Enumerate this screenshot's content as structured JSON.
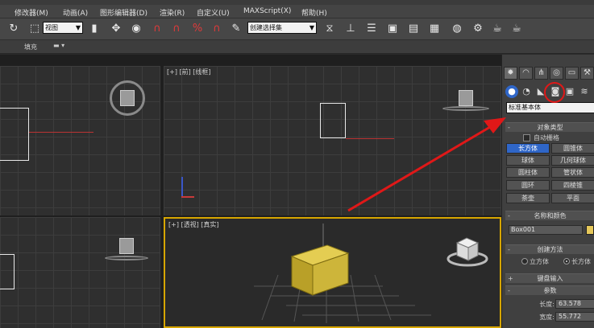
{
  "menu": {
    "items": [
      "修改器(M)",
      "动画(A)",
      "图形编辑器(D)",
      "渲染(R)",
      "自定义(U)",
      "MAXScript(X)",
      "帮助(H)"
    ]
  },
  "toolbar": {
    "view_select": "视图",
    "selection_set": "创建选择集"
  },
  "subbar": {
    "label": "填充"
  },
  "viewports": {
    "top_center_label": "[+] [前] [线框]",
    "perspective_label": "[+] [透视] [真实]"
  },
  "panel": {
    "dropdown": "标准基本体",
    "object_type_header": "对象类型",
    "autogrid": "自动栅格",
    "object_buttons": [
      "长方体",
      "圆锥体",
      "球体",
      "几何球体",
      "圆柱体",
      "管状体",
      "圆环",
      "四棱锥",
      "茶壶",
      "平面"
    ],
    "name_color_header": "名称和颜色",
    "object_name": "Box001",
    "object_color": "#e6c85a",
    "creation_method_header": "创建方法",
    "method_cube": "立方体",
    "method_box": "长方体",
    "keyboard_header": "键盘输入",
    "params_header": "参数",
    "length_label": "长度:",
    "length_value": "63.578",
    "width_label": "宽度:",
    "width_value": "55.772"
  },
  "colors": {
    "accent_blue": "#2f66c8",
    "active_viewport_border": "#d7a600",
    "highlight_red": "#e01818",
    "box_yellow": "#d8bf3a"
  }
}
